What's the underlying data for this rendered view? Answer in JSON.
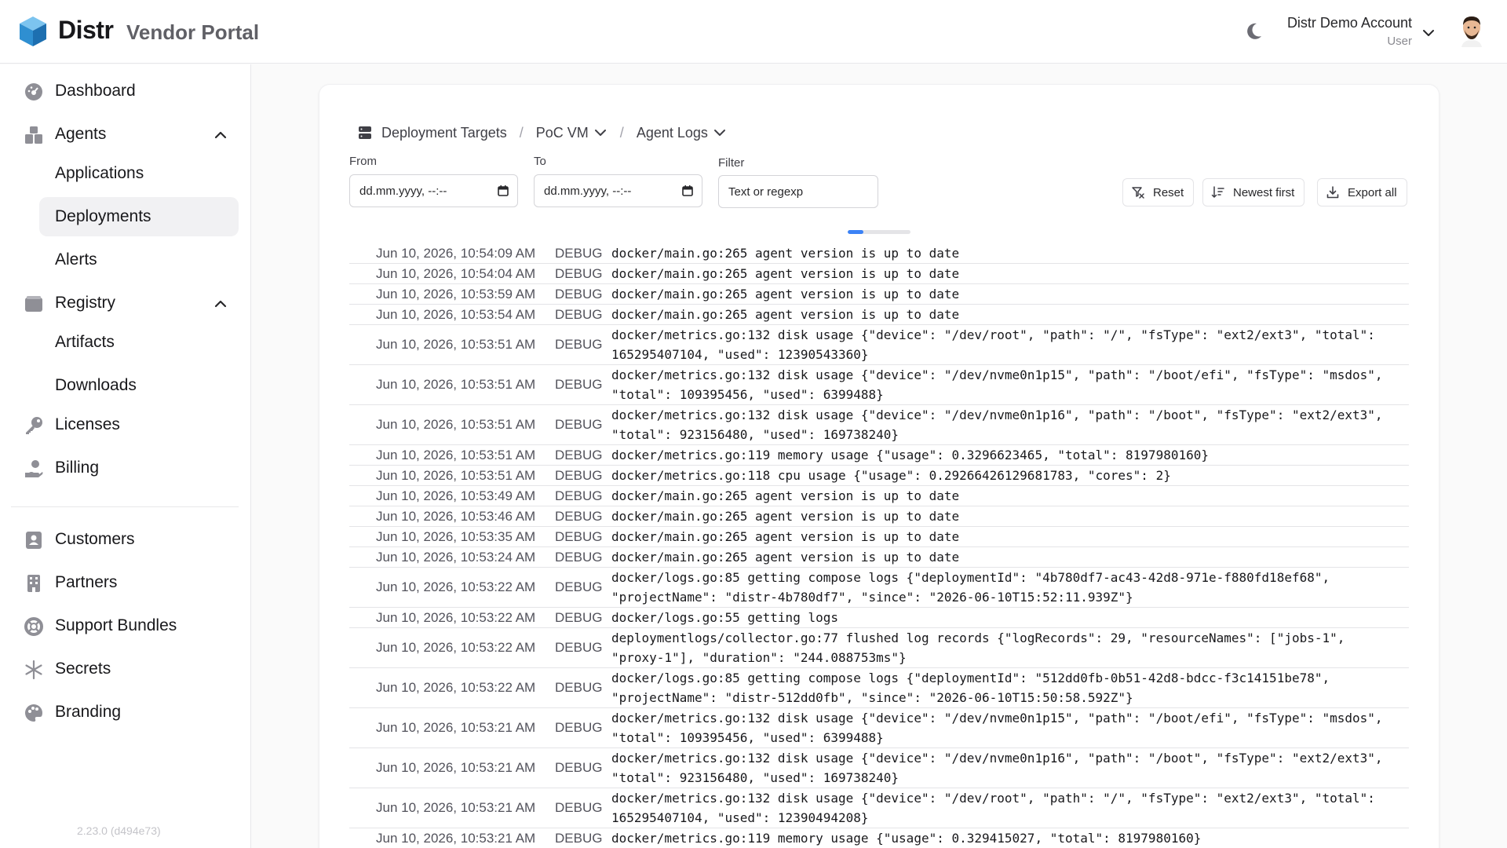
{
  "header": {
    "brand": "Distr",
    "portal": "Vendor Portal",
    "account_name": "Distr Demo Account",
    "account_role": "User",
    "icons": [
      "distr-logo",
      "moon-icon",
      "chevron-down-icon",
      "avatar"
    ]
  },
  "sidebar": {
    "items": [
      {
        "label": "Dashboard",
        "icon": "dashboard-icon"
      },
      {
        "label": "Agents",
        "icon": "agents-icon"
      },
      {
        "label": "Applications"
      },
      {
        "label": "Deployments"
      },
      {
        "label": "Alerts"
      },
      {
        "label": "Registry",
        "icon": "registry-icon"
      },
      {
        "label": "Artifacts"
      },
      {
        "label": "Downloads"
      },
      {
        "label": "Licenses",
        "icon": "key-icon"
      },
      {
        "label": "Billing",
        "icon": "billing-icon"
      },
      {
        "label": "Customers",
        "icon": "customers-icon"
      },
      {
        "label": "Partners",
        "icon": "partners-icon"
      },
      {
        "label": "Support Bundles",
        "icon": "support-icon"
      },
      {
        "label": "Secrets",
        "icon": "asterisk-icon"
      },
      {
        "label": "Branding",
        "icon": "palette-icon"
      }
    ],
    "active": "Deployments",
    "version": "2.23.0 (d494e73)"
  },
  "breadcrumb": {
    "root": "Deployment Targets",
    "target": "PoC VM",
    "page": "Agent Logs",
    "sep": "/"
  },
  "filters": {
    "from_label": "From",
    "from_value": "dd.mm.yyyy, --:--",
    "to_label": "To",
    "to_value": "dd.mm.yyyy, --:--",
    "filter_label": "Filter",
    "filter_placeholder": "Text or regexp"
  },
  "actions": {
    "reset": "Reset",
    "sort": "Newest first",
    "export": "Export all"
  },
  "progress": {
    "fraction": 0.25,
    "color": "#3b82f6"
  },
  "logs": [
    {
      "ts": "Jun 10, 2026, 10:54:09 AM",
      "level": "DEBUG",
      "msg": "docker/main.go:265 agent version is up to date"
    },
    {
      "ts": "Jun 10, 2026, 10:54:04 AM",
      "level": "DEBUG",
      "msg": "docker/main.go:265 agent version is up to date"
    },
    {
      "ts": "Jun 10, 2026, 10:53:59 AM",
      "level": "DEBUG",
      "msg": "docker/main.go:265 agent version is up to date"
    },
    {
      "ts": "Jun 10, 2026, 10:53:54 AM",
      "level": "DEBUG",
      "msg": "docker/main.go:265 agent version is up to date"
    },
    {
      "ts": "Jun 10, 2026, 10:53:51 AM",
      "level": "DEBUG",
      "msg": "docker/metrics.go:132 disk usage {\"device\": \"/dev/root\", \"path\": \"/\", \"fsType\": \"ext2/ext3\", \"total\": 165295407104, \"used\": 12390543360}"
    },
    {
      "ts": "Jun 10, 2026, 10:53:51 AM",
      "level": "DEBUG",
      "msg": "docker/metrics.go:132 disk usage {\"device\": \"/dev/nvme0n1p15\", \"path\": \"/boot/efi\", \"fsType\": \"msdos\", \"total\": 109395456, \"used\": 6399488}"
    },
    {
      "ts": "Jun 10, 2026, 10:53:51 AM",
      "level": "DEBUG",
      "msg": "docker/metrics.go:132 disk usage {\"device\": \"/dev/nvme0n1p16\", \"path\": \"/boot\", \"fsType\": \"ext2/ext3\", \"total\": 923156480, \"used\": 169738240}"
    },
    {
      "ts": "Jun 10, 2026, 10:53:51 AM",
      "level": "DEBUG",
      "msg": "docker/metrics.go:119 memory usage {\"usage\": 0.3296623465, \"total\": 8197980160}"
    },
    {
      "ts": "Jun 10, 2026, 10:53:51 AM",
      "level": "DEBUG",
      "msg": "docker/metrics.go:118 cpu usage {\"usage\": 0.29266426129681783, \"cores\": 2}"
    },
    {
      "ts": "Jun 10, 2026, 10:53:49 AM",
      "level": "DEBUG",
      "msg": "docker/main.go:265 agent version is up to date"
    },
    {
      "ts": "Jun 10, 2026, 10:53:46 AM",
      "level": "DEBUG",
      "msg": "docker/main.go:265 agent version is up to date"
    },
    {
      "ts": "Jun 10, 2026, 10:53:35 AM",
      "level": "DEBUG",
      "msg": "docker/main.go:265 agent version is up to date"
    },
    {
      "ts": "Jun 10, 2026, 10:53:24 AM",
      "level": "DEBUG",
      "msg": "docker/main.go:265 agent version is up to date"
    },
    {
      "ts": "Jun 10, 2026, 10:53:22 AM",
      "level": "DEBUG",
      "msg": "docker/logs.go:85 getting compose logs {\"deploymentId\": \"4b780df7-ac43-42d8-971e-f880fd18ef68\", \"projectName\": \"distr-4b780df7\", \"since\": \"2026-06-10T15:52:11.939Z\"}"
    },
    {
      "ts": "Jun 10, 2026, 10:53:22 AM",
      "level": "DEBUG",
      "msg": "docker/logs.go:55 getting logs"
    },
    {
      "ts": "Jun 10, 2026, 10:53:22 AM",
      "level": "DEBUG",
      "msg": "deploymentlogs/collector.go:77 flushed log records {\"logRecords\": 29, \"resourceNames\": [\"jobs-1\", \"proxy-1\"], \"duration\": \"244.088753ms\"}"
    },
    {
      "ts": "Jun 10, 2026, 10:53:22 AM",
      "level": "DEBUG",
      "msg": "docker/logs.go:85 getting compose logs {\"deploymentId\": \"512dd0fb-0b51-42d8-bdcc-f3c14151be78\", \"projectName\": \"distr-512dd0fb\", \"since\": \"2026-06-10T15:50:58.592Z\"}"
    },
    {
      "ts": "Jun 10, 2026, 10:53:21 AM",
      "level": "DEBUG",
      "msg": "docker/metrics.go:132 disk usage {\"device\": \"/dev/nvme0n1p15\", \"path\": \"/boot/efi\", \"fsType\": \"msdos\", \"total\": 109395456, \"used\": 6399488}"
    },
    {
      "ts": "Jun 10, 2026, 10:53:21 AM",
      "level": "DEBUG",
      "msg": "docker/metrics.go:132 disk usage {\"device\": \"/dev/nvme0n1p16\", \"path\": \"/boot\", \"fsType\": \"ext2/ext3\", \"total\": 923156480, \"used\": 169738240}"
    },
    {
      "ts": "Jun 10, 2026, 10:53:21 AM",
      "level": "DEBUG",
      "msg": "docker/metrics.go:132 disk usage {\"device\": \"/dev/root\", \"path\": \"/\", \"fsType\": \"ext2/ext3\", \"total\": 165295407104, \"used\": 12390494208}"
    },
    {
      "ts": "Jun 10, 2026, 10:53:21 AM",
      "level": "DEBUG",
      "msg": "docker/metrics.go:119 memory usage {\"usage\": 0.329415027, \"total\": 8197980160}"
    }
  ]
}
